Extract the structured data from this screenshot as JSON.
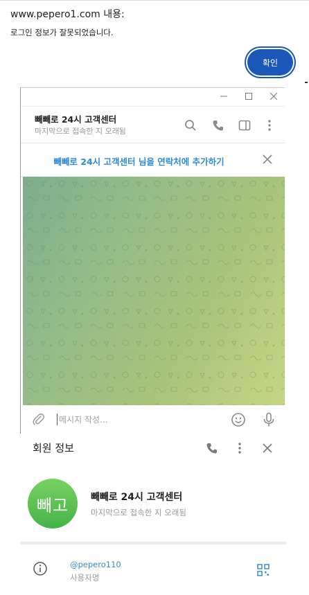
{
  "alert": {
    "title": "www.pepero1.com 내용:",
    "message": "로그인 정보가 잘못되었습니다.",
    "ok_label": "확인"
  },
  "chat": {
    "window_controls": [
      "minimize-icon",
      "maximize-icon",
      "close-icon"
    ],
    "contact_name": "빼빼로 24시 고객센터",
    "contact_status": "마지막으로 접속한 지 오래됨",
    "header_icons": [
      "search-icon",
      "phone-icon",
      "sidebar-icon",
      "more-icon"
    ],
    "add_contact_text": "빼빼로 24시 고객센터 님을 연락처에 추가하기",
    "composer_placeholder": "메시지 작성...",
    "colors": {
      "accent": "#2f8ad6",
      "bg_start": "#7fae8d",
      "bg_end": "#c6d586"
    }
  },
  "info_panel": {
    "title": "회원 정보",
    "avatar_initials": "빼고",
    "name": "빼빼로 24시 고객센터",
    "status": "마지막으로 접속한 지 오래됨",
    "username": "@pepero110",
    "username_label": "사용자명",
    "colors": {
      "avatar": "#4fbf4f"
    }
  }
}
